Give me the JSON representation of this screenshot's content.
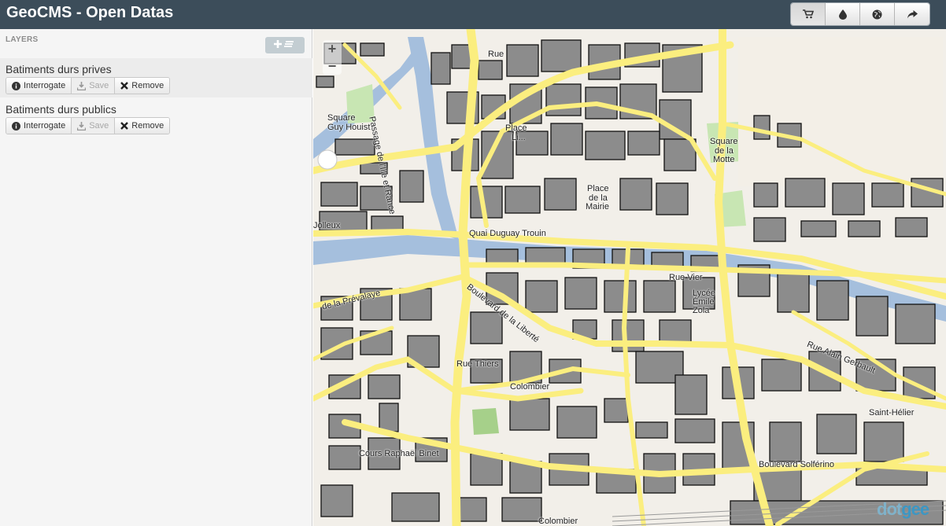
{
  "app": {
    "title": "GeoCMS - Open Datas"
  },
  "toolbar": {
    "buttons": [
      {
        "name": "cart",
        "icon": "cart-icon"
      },
      {
        "name": "drop",
        "icon": "drop-icon"
      },
      {
        "name": "globe",
        "icon": "globe-icon"
      },
      {
        "name": "share",
        "icon": "share-icon"
      }
    ]
  },
  "sidebar": {
    "heading": "LAYERS",
    "add_button_icon": "add-layer-icon",
    "layers": [
      {
        "name": "Batiments durs prives",
        "interrogate": "Interrogate",
        "save": "Save",
        "remove": "Remove"
      },
      {
        "name": "Batiments durs publics",
        "interrogate": "Interrogate",
        "save": "Save",
        "remove": "Remove"
      }
    ]
  },
  "map": {
    "zoom_in": "+",
    "zoom_out": "−",
    "labels": {
      "rue_a": "Rue",
      "passage": "Passage de l'Ille et Rance",
      "square_guy": "Square",
      "square_guy2": "Guy Houist",
      "place_a": "Place",
      "place_a2": "Li...",
      "square_motte": "Square",
      "square_motte2": "de la",
      "square_motte3": "Motte",
      "place_mairie": "Place",
      "place_mairie2": "de la",
      "place_mairie3": "Mairie",
      "quai": "Quai Duguay Trouin",
      "rue_vier": "Rue Vier",
      "lycee": "Lycée",
      "emile": "Émile",
      "zola": "Zola",
      "prevalaye": "de la Prévalaye",
      "bd_liberte": "Boulevard de la Liberté",
      "rue_thiers": "Rue Thiers",
      "colombier": "Colombier",
      "cours": "Cours Raphaël Binet",
      "rue_alain": "Rue Alain Gerbault",
      "saint_helier": "Saint-Hélier",
      "bd_solferino": "Boulevard Solférino",
      "colombier2": "Colombier",
      "ouest": "Jolleux"
    },
    "brand_a": "dot",
    "brand_b": "gee"
  },
  "colors": {
    "topbar": "#3c4d5a",
    "road": "#fbee7f",
    "building": "#888888",
    "water": "#a5bfdd",
    "park": "#c8e6b3"
  }
}
